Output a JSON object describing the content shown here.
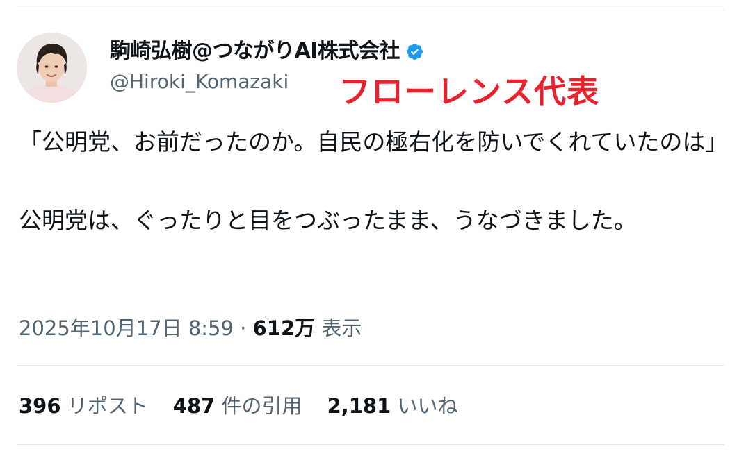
{
  "author": {
    "display_name": "駒崎弘樹@つながりAI株式会社",
    "handle": "@Hiroki_Komazaki",
    "verified": true,
    "verified_color": "#1d9bf0"
  },
  "overlay_caption": "フローレンス代表",
  "overlay_color": "#e8232e",
  "tweet": {
    "paragraph_1": "「公明党、お前だったのか。自民の極右化を防いでくれていたのは」",
    "paragraph_2": "公明党は、ぐったりと目をつぶったまま、うなづきました。"
  },
  "meta": {
    "timestamp": "2025年10月17日 8:59",
    "separator": "·",
    "views_count": "612万",
    "views_label": "表示"
  },
  "stats": {
    "reposts_count": "396",
    "reposts_label": "リポスト",
    "quotes_count": "487",
    "quotes_label": "件の引用",
    "likes_count": "2,181",
    "likes_label": "いいね"
  }
}
